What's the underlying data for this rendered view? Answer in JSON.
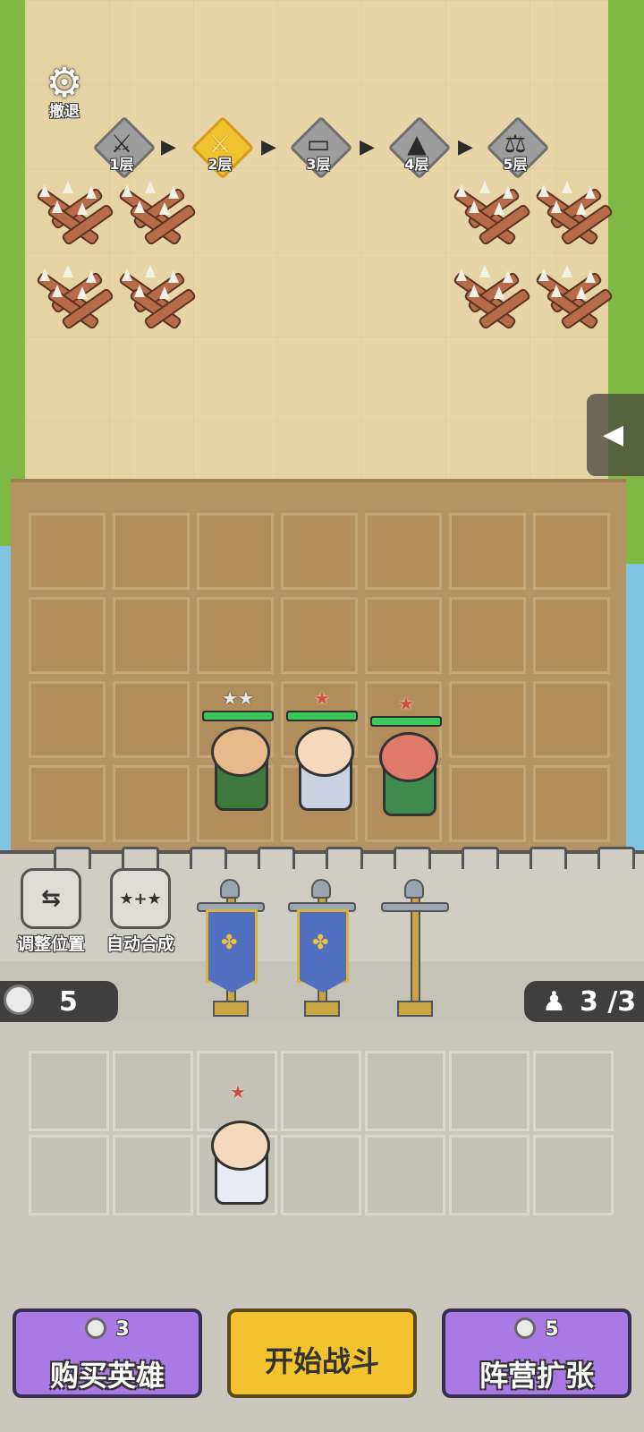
{
  "top": {
    "settings_label": "撤退"
  },
  "floors": [
    {
      "label": "1层",
      "icon": "sword-icon",
      "active": false
    },
    {
      "label": "2层",
      "icon": "crossed-swords-icon",
      "active": true
    },
    {
      "label": "3层",
      "icon": "treasure-chest-icon",
      "active": false
    },
    {
      "label": "4层",
      "icon": "mystery-icon",
      "active": false
    },
    {
      "label": "5层",
      "icon": "balance-scale-icon",
      "active": false
    }
  ],
  "controls": {
    "adjust_label": "调整位置",
    "auto_merge_label": "自动合成"
  },
  "resources": {
    "coins": "5",
    "population": "3 /3"
  },
  "heroes_on_board": [
    {
      "stars": "★★",
      "star_color": "silver",
      "hp_pct": 100,
      "name": "brawler-hero"
    },
    {
      "stars": "★",
      "star_color": "red",
      "hp_pct": 100,
      "name": "shield-knight-hero"
    },
    {
      "stars": "★",
      "star_color": "red",
      "hp_pct": 100,
      "name": "halberd-general-hero"
    }
  ],
  "bench_heroes": [
    {
      "stars": "★",
      "star_color": "red",
      "name": "strategist-hero"
    }
  ],
  "buttons": {
    "buy_hero": {
      "cost": "3",
      "label": "购买英雄"
    },
    "start_battle": {
      "label": "开始战斗"
    },
    "expand_camp": {
      "cost": "5",
      "label": "阵营扩张"
    }
  },
  "colors": {
    "accent_purple": "#a97ae3",
    "accent_yellow": "#f2c32e",
    "hp_green": "#3cc85a"
  }
}
